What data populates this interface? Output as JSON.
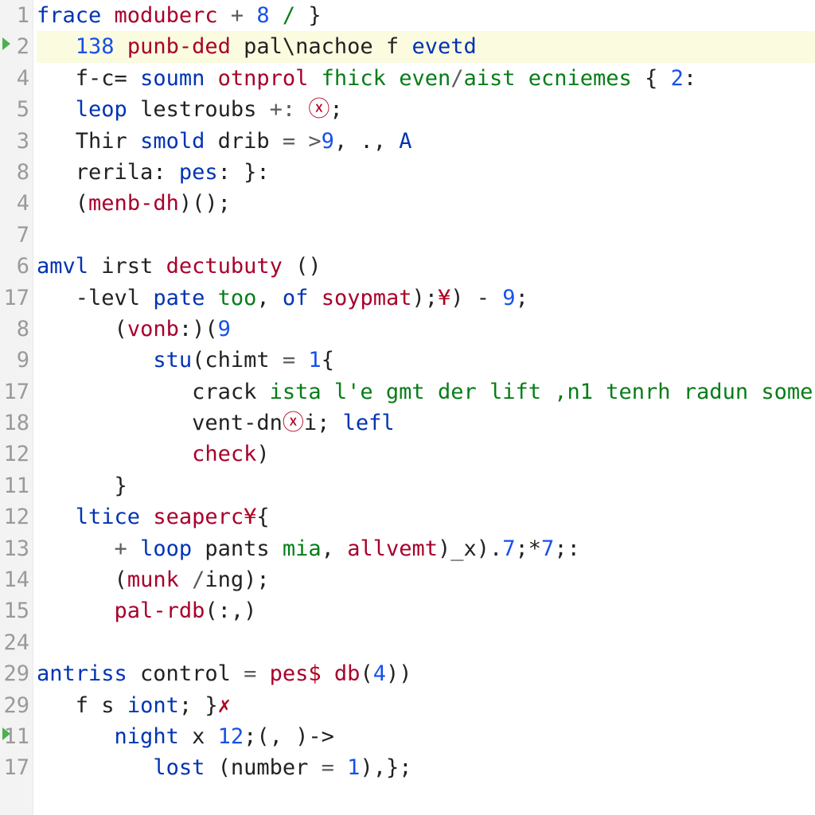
{
  "editor": {
    "highlighted_line_index": 1,
    "line_numbers": [
      "1",
      "2",
      "4",
      "5",
      "3",
      "8",
      "4",
      "7",
      "6",
      "17",
      "8",
      "9",
      "17",
      "18",
      "12",
      "11",
      "12",
      "13",
      "14",
      "15",
      "24",
      "29",
      "29",
      "11",
      "17"
    ],
    "modified_markers": [
      1,
      23
    ],
    "lines": [
      {
        "indent": 0,
        "tokens": [
          [
            "kw",
            "frace "
          ],
          [
            "fn",
            "moduberc"
          ],
          [
            "op",
            " + "
          ],
          [
            "num",
            "8"
          ],
          [
            "str",
            " / "
          ],
          [
            "pnc",
            "}"
          ]
        ]
      },
      {
        "indent": 1,
        "tokens": [
          [
            "num",
            "138 "
          ],
          [
            "fn",
            "punb-ded "
          ],
          [
            "id",
            "pal\\nachoe f "
          ],
          [
            "kw",
            "evetd"
          ]
        ]
      },
      {
        "indent": 1,
        "tokens": [
          [
            "id",
            "f-c= "
          ],
          [
            "kw",
            "soumn "
          ],
          [
            "fn",
            "otnprol "
          ],
          [
            "str",
            "fhick even"
          ],
          [
            "op",
            "/"
          ],
          [
            "str",
            "aist ecniemes"
          ],
          [
            "pnc",
            " { "
          ],
          [
            "num",
            "2"
          ],
          [
            "pnc",
            ":"
          ]
        ]
      },
      {
        "indent": 1,
        "tokens": [
          [
            "kw",
            "leop "
          ],
          [
            "id",
            "lestroubs "
          ],
          [
            "op",
            "+: "
          ],
          [
            "err",
            "ⓧ"
          ],
          [
            "pnc",
            ";"
          ]
        ]
      },
      {
        "indent": 1,
        "tokens": [
          [
            "id",
            "Thir "
          ],
          [
            "kw",
            "smold "
          ],
          [
            "id",
            "drib "
          ],
          [
            "op",
            "= >"
          ],
          [
            "num",
            "9"
          ],
          [
            "pnc",
            ", ., "
          ],
          [
            "kw",
            "A"
          ]
        ]
      },
      {
        "indent": 1,
        "tokens": [
          [
            "id",
            "rerila: "
          ],
          [
            "kw",
            "pes"
          ],
          [
            "pnc",
            ": }:"
          ]
        ]
      },
      {
        "indent": 1,
        "tokens": [
          [
            "pnc",
            "("
          ],
          [
            "fn",
            "menb-dh"
          ],
          [
            "pnc",
            ")();"
          ]
        ]
      },
      {
        "blank": true
      },
      {
        "indent": 0,
        "tokens": [
          [
            "kw",
            "amvl "
          ],
          [
            "id",
            "irst "
          ],
          [
            "fn",
            "dectubuty "
          ],
          [
            "pnc",
            "()"
          ]
        ]
      },
      {
        "indent": 1,
        "tokens": [
          [
            "id",
            "-levl "
          ],
          [
            "kw",
            "pate "
          ],
          [
            "str",
            "too"
          ],
          [
            "pnc",
            ", "
          ],
          [
            "kw",
            "of "
          ],
          [
            "fn",
            "soypmat"
          ],
          [
            "pnc",
            ");"
          ],
          [
            "err",
            "¥"
          ],
          [
            "pnc",
            ") - "
          ],
          [
            "num",
            "9"
          ],
          [
            "pnc",
            ";"
          ]
        ]
      },
      {
        "indent": 2,
        "tokens": [
          [
            "pnc",
            "("
          ],
          [
            "fn",
            "vonb"
          ],
          [
            "pnc",
            ":)("
          ],
          [
            "num",
            "9"
          ]
        ]
      },
      {
        "indent": 3,
        "tokens": [
          [
            "kw",
            "stu"
          ],
          [
            "pnc",
            "("
          ],
          [
            "id",
            "chimt "
          ],
          [
            "op",
            "= "
          ],
          [
            "num",
            "1"
          ],
          [
            "pnc",
            "{"
          ]
        ]
      },
      {
        "indent": 4,
        "tokens": [
          [
            "id",
            "crack "
          ],
          [
            "str",
            "ista l'e gmt der lift ,n1 tenrh radun some"
          ]
        ]
      },
      {
        "indent": 4,
        "tokens": [
          [
            "id",
            "vent-dn"
          ],
          [
            "err",
            "ⓧ"
          ],
          [
            "id",
            "i; "
          ],
          [
            "kw",
            "lefl"
          ]
        ]
      },
      {
        "indent": 4,
        "tokens": [
          [
            "fn",
            "check"
          ],
          [
            "pnc",
            ")"
          ]
        ]
      },
      {
        "indent": 2,
        "tokens": [
          [
            "pnc",
            "}"
          ]
        ]
      },
      {
        "indent": 1,
        "tokens": [
          [
            "kw",
            "ltice "
          ],
          [
            "fn",
            "seaperc"
          ],
          [
            "err",
            "¥"
          ],
          [
            "pnc",
            "{"
          ]
        ]
      },
      {
        "indent": 2,
        "tokens": [
          [
            "op",
            "+ "
          ],
          [
            "kw",
            "loop "
          ],
          [
            "id",
            "pants "
          ],
          [
            "str",
            "mia"
          ],
          [
            "pnc",
            ", "
          ],
          [
            "fn",
            "allvemt"
          ],
          [
            "pnc",
            ")_x)."
          ],
          [
            "num",
            "7"
          ],
          [
            "pnc",
            ";*"
          ],
          [
            "num",
            "7"
          ],
          [
            "pnc",
            ";:"
          ]
        ]
      },
      {
        "indent": 2,
        "tokens": [
          [
            "pnc",
            "("
          ],
          [
            "fn",
            "munk "
          ],
          [
            "op",
            "/"
          ],
          [
            "id",
            "ing"
          ],
          [
            "pnc",
            ");"
          ]
        ]
      },
      {
        "indent": 2,
        "tokens": [
          [
            "fn",
            "pal-rdb"
          ],
          [
            "pnc",
            "(:,)"
          ]
        ]
      },
      {
        "blank": true
      },
      {
        "indent": 0,
        "tokens": [
          [
            "kw",
            "antriss "
          ],
          [
            "id",
            "control "
          ],
          [
            "op",
            "= "
          ],
          [
            "fn",
            "pes"
          ],
          [
            "err",
            "$"
          ],
          [
            "fn",
            " db"
          ],
          [
            "pnc",
            "("
          ],
          [
            "num",
            "4"
          ],
          [
            "pnc",
            "))"
          ]
        ]
      },
      {
        "indent": 1,
        "tokens": [
          [
            "id",
            "f s "
          ],
          [
            "kw",
            "iont"
          ],
          [
            "pnc",
            "; }"
          ],
          [
            "err",
            "✗"
          ]
        ]
      },
      {
        "indent": 2,
        "tokens": [
          [
            "kw",
            "night "
          ],
          [
            "id",
            "x "
          ],
          [
            "num",
            "12"
          ],
          [
            "pnc",
            ";(, )->"
          ]
        ]
      },
      {
        "indent": 3,
        "tokens": [
          [
            "kw",
            "lost "
          ],
          [
            "pnc",
            "("
          ],
          [
            "id",
            "number "
          ],
          [
            "op",
            "= "
          ],
          [
            "num",
            "1"
          ],
          [
            "pnc",
            "),};"
          ]
        ]
      }
    ]
  }
}
